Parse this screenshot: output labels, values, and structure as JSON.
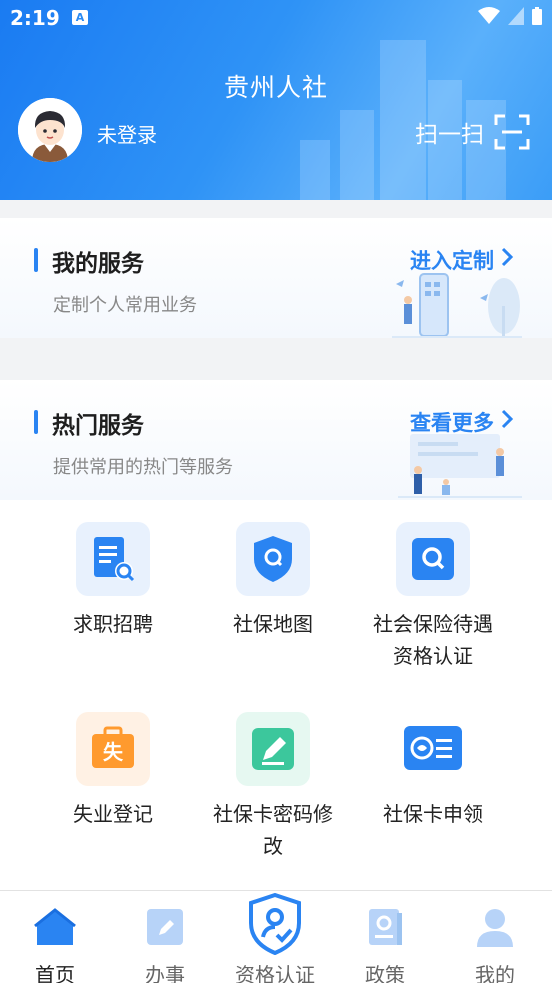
{
  "status_bar": {
    "time": "2:19",
    "notification": "A"
  },
  "header": {
    "title": "贵州人社",
    "login_status": "未登录",
    "scan_label": "扫一扫"
  },
  "my_services": {
    "title": "我的服务",
    "subtitle": "定制个人常用业务",
    "link": "进入定制"
  },
  "hot_services": {
    "title": "热门服务",
    "subtitle": "提供常用的热门等服务",
    "link": "查看更多"
  },
  "services": [
    {
      "label": "求职招聘",
      "icon": "job-search-icon"
    },
    {
      "label": "社保地图",
      "icon": "map-shield-icon"
    },
    {
      "label": "社会保险待遇资格认证",
      "label_line1": "社会保险待遇",
      "label_line2": "资格认证",
      "icon": "search-icon"
    },
    {
      "label": "失业登记",
      "icon": "unemployment-briefcase-icon",
      "badge": "失"
    },
    {
      "label": "社保卡密码修改",
      "label_line1": "社保卡密码修",
      "label_line2": "改",
      "icon": "edit-icon"
    },
    {
      "label": "社保卡申领",
      "icon": "social-security-card-icon"
    }
  ],
  "bottom_nav": [
    {
      "label": "首页",
      "icon": "home-icon",
      "active": true
    },
    {
      "label": "办事",
      "icon": "edit-icon"
    },
    {
      "label": "资格认证",
      "icon": "shield-user-icon"
    },
    {
      "label": "政策",
      "icon": "policy-book-icon"
    },
    {
      "label": "我的",
      "icon": "user-icon"
    }
  ],
  "colors": {
    "primary": "#2a84f2",
    "header": "#1a7bf2",
    "orange": "#ff9a2e",
    "green": "#3cc79c"
  }
}
